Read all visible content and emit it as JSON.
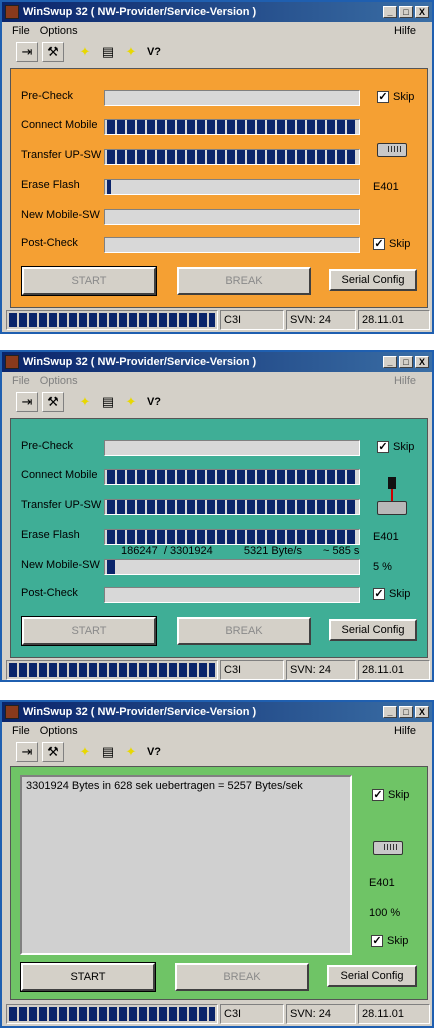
{
  "colors": {
    "panel1": "#f5a033",
    "panel2": "#3fae96",
    "panel3": "#6fc466",
    "progress": "#0a246a"
  },
  "window_title": "WinSwup 32 ( NW-Provider/Service-Version )",
  "menu": {
    "file": "File",
    "options": "Options",
    "help": "Hilfe"
  },
  "title_buttons": {
    "minimize": "_",
    "maximize": "□",
    "close": "X"
  },
  "toolbar": {
    "v_label": "V?"
  },
  "labels": {
    "pre_check": "Pre-Check",
    "connect_mobile": "Connect Mobile",
    "transfer": "Transfer UP-SW",
    "erase_flash": "Erase Flash",
    "new_sw": "New Mobile-SW",
    "post_check": "Post-Check"
  },
  "skip_label": "Skip",
  "check_mark": "✓",
  "buttons": {
    "start": "START",
    "break": "BREAK",
    "serial": "Serial Config"
  },
  "statusbar": {
    "model": "C3I",
    "svn": "SVN: 24",
    "date": "28.11.01"
  },
  "window1": {
    "progress": {
      "pre_check": 0,
      "connect_mobile": 1.0,
      "transfer": 1.0,
      "erase_flash": 0.03,
      "new_sw": 0,
      "post_check": 0
    },
    "error": "E401"
  },
  "window2": {
    "progress": {
      "pre_check": 0,
      "connect_mobile": 1.0,
      "transfer": 1.0,
      "erase_flash": 1.0,
      "new_sw": 0.05,
      "post_check": 0
    },
    "error": "E401",
    "percent": "5 %",
    "rates": {
      "bytes": "186247",
      "total": "/ 3301924",
      "speed": "5321 Byte/s",
      "time": "~ 585 s"
    }
  },
  "window3": {
    "log": "3301924 Bytes in 628 sek uebertragen = 5257 Bytes/sek",
    "error": "E401",
    "percent": "100 %"
  }
}
